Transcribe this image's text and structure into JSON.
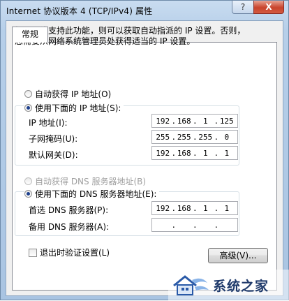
{
  "window": {
    "title": "Internet 协议版本 4 (TCP/IPv4) 属性",
    "help_label": "?",
    "close_label": "X"
  },
  "tabs": [
    {
      "label": "常规"
    }
  ],
  "description": [
    "如果网络支持此功能，则可以获取自动指派的 IP 设置。否则，",
    "您需要从网络系统管理员处获得适当的 IP 设置。"
  ],
  "ip_section": {
    "auto_label": "自动获得 IP 地址(O)",
    "manual_label": "使用下面的 IP 地址(S):",
    "selected": "manual",
    "fields": [
      {
        "label": "IP 地址(I):",
        "octets": [
          "192",
          "168",
          "1",
          "125"
        ]
      },
      {
        "label": "子网掩码(U):",
        "octets": [
          "255",
          "255",
          "255",
          "0"
        ]
      },
      {
        "label": "默认网关(D):",
        "octets": [
          "192",
          "168",
          "1",
          "1"
        ]
      }
    ],
    "dots": [
      "."
    ]
  },
  "dns_section": {
    "auto_label": "自动获得 DNS 服务器地址(B)",
    "manual_label": "使用下面的 DNS 服务器地址(E):",
    "selected": "manual",
    "auto_disabled": true,
    "fields": [
      {
        "label": "首选 DNS 服务器(P):",
        "octets": [
          "192",
          "168",
          "1",
          "1"
        ]
      },
      {
        "label": "备用 DNS 服务器(A):",
        "octets": [
          "",
          "",
          "",
          ""
        ]
      }
    ]
  },
  "validate_on_exit": {
    "label": "退出时验证设置(L)",
    "checked": false
  },
  "advanced_button": {
    "label": "高级(V)..."
  },
  "watermark": {
    "text": "系统之家",
    "icon": "house-logo-icon"
  },
  "colors": {
    "selected_radio": "#1c3f8c",
    "title_bg": "#b6cfe9",
    "close_bg": "#c8432c"
  }
}
